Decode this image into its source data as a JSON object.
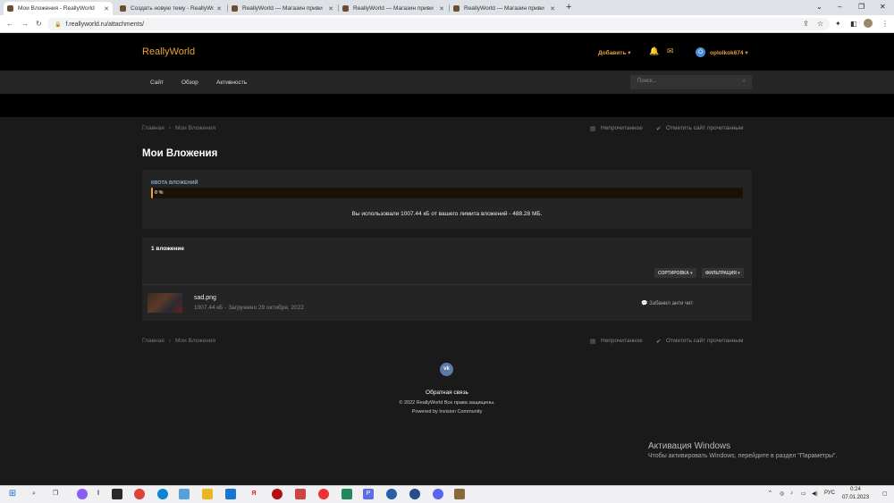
{
  "browser": {
    "tabs": [
      {
        "title": "Мои Вложения - ReallyWorld",
        "active": true
      },
      {
        "title": "Создать новую тему - ReallyWo",
        "active": false
      },
      {
        "title": "ReallyWorld — Магазин приви",
        "active": false
      },
      {
        "title": "ReallyWorld — Магазин приви",
        "active": false
      },
      {
        "title": "ReallyWorld — Магазин приви",
        "active": false
      }
    ],
    "url": "f.reallyworld.ru/attachments/"
  },
  "site": {
    "logo": "ReallyWorld",
    "add_label": "Добавить ▾",
    "username": "oplolkok674 ▾",
    "user_initial": "O",
    "nav": [
      "Сайт",
      "Обзор",
      "Активность"
    ],
    "search_placeholder": "Поиск..."
  },
  "breadcrumb": {
    "home": "Главная",
    "sep": "›",
    "current": "Мои Вложения"
  },
  "actions": {
    "unread": "Непрочитанное",
    "mark_read": "Отметить сайт прочитанным"
  },
  "page_title": "Мои Вложения",
  "quota": {
    "label": "КВОТА ВЛОЖЕНИЙ",
    "percent_text": "0 %",
    "used_fraction": 0.0,
    "usage_text": "Вы использовали 1007.44 кБ от вашего лимита вложений - 488.28 МБ."
  },
  "attachments": {
    "count_label": "1 вложение",
    "sort_label": "СОРТИРОВКА ▾",
    "filter_label": "ФИЛЬТРАЦИЯ ▾",
    "items": [
      {
        "name": "sad.png",
        "meta": "1007.44 кБ - Загружено 29 октября, 2022",
        "topic": "Забанил анти чит"
      }
    ]
  },
  "footer": {
    "vk_label": "vk",
    "feedback": "Обратная связь",
    "copyright": "© 2022 ReallyWorld Все права защищены.",
    "powered": "Powered by Invision Community"
  },
  "windows": {
    "activation_title": "Активация Windows",
    "activation_sub": "Чтобы активировать Windows, перейдите в раздел \"Параметры\".",
    "time": "0:24",
    "date": "07.01.2023",
    "lang": "РУС"
  },
  "colors": {
    "accent": "#e8a23a",
    "bg": "#1a1a1a",
    "panel": "#242424"
  }
}
